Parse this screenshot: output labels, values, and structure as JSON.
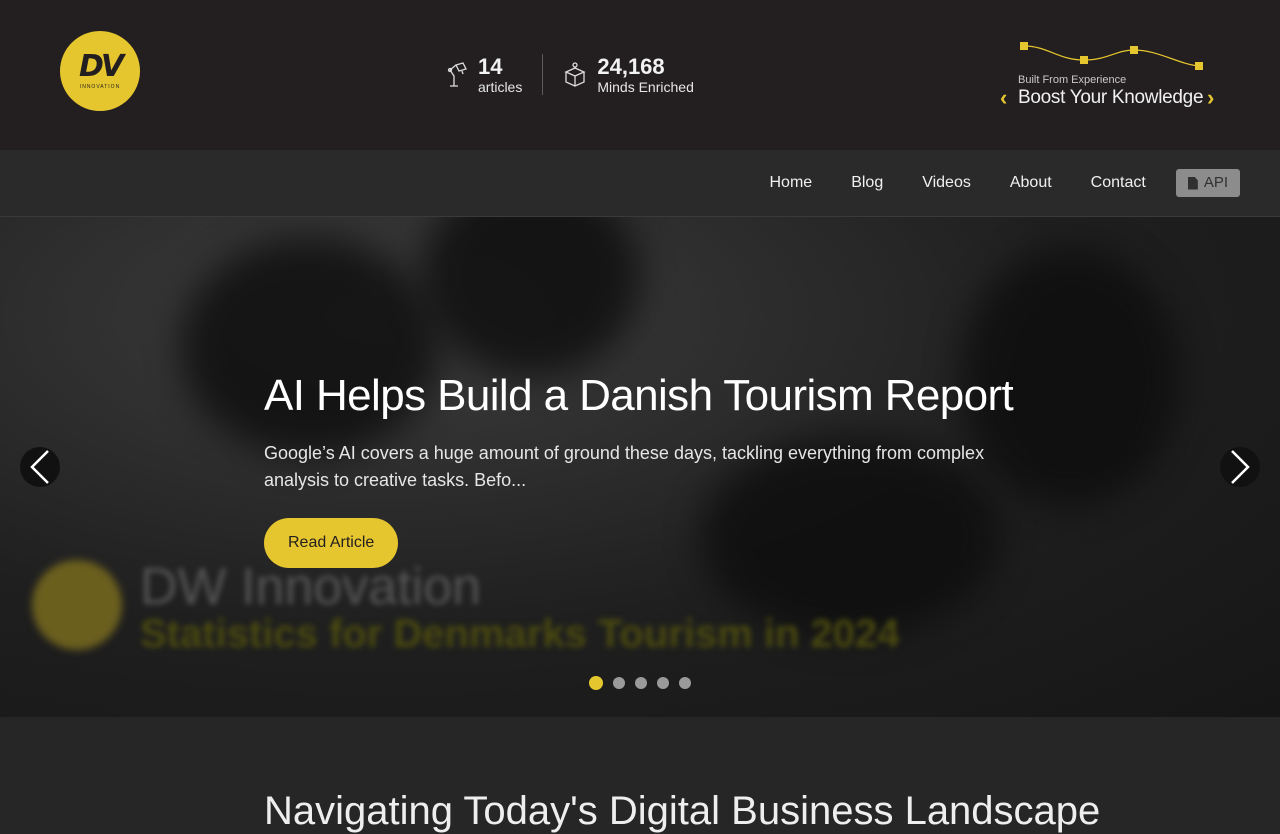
{
  "header": {
    "logo": {
      "mark": "DV",
      "subtitle": "INNOVATION"
    },
    "stats": [
      {
        "number": "14",
        "label": "articles",
        "icon": "desk-lamp-icon"
      },
      {
        "number": "24,168",
        "label": "Minds Enriched",
        "icon": "open-box-icon"
      }
    ],
    "tagline": {
      "small": "Built From Experience",
      "big": "Boost Your Knowledge"
    },
    "accent_color": "#e6c62e"
  },
  "nav": {
    "items": [
      "Home",
      "Blog",
      "Videos",
      "About",
      "Contact"
    ],
    "api_label": "API"
  },
  "hero": {
    "title": "AI Helps Build a Danish Tourism Report",
    "excerpt": "Google’s AI covers a huge amount of ground these days, tackling everything from complex analysis to creative tasks. Befo...",
    "button_label": "Read Article",
    "background_title": "DW Innovation",
    "background_subtitle": "Statistics for Denmarks Tourism in 2024",
    "slide_count": 5,
    "active_slide": 1
  },
  "section": {
    "heading": "Navigating Today's Digital Business Landscape"
  }
}
